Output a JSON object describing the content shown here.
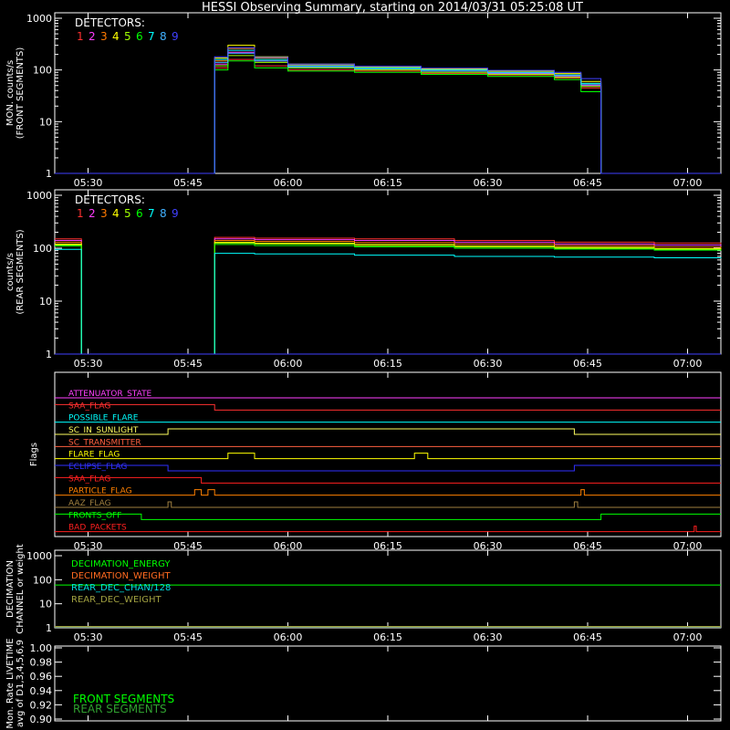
{
  "title": "HESSI Observing Summary, starting on 2014/03/31 05:25:08 UT",
  "detector_colors": [
    "#ff3030",
    "#ff3cff",
    "#ff7a00",
    "#ffff00",
    "#a0ff00",
    "#00ff00",
    "#00ffff",
    "#40b0ff",
    "#4040ff"
  ],
  "time_axis": {
    "start": "05:25:08",
    "end": "07:05",
    "ticks": [
      "05:30",
      "05:45",
      "06:00",
      "06:15",
      "06:30",
      "06:45",
      "07:00"
    ]
  },
  "chart_data": [
    {
      "type": "line",
      "id": "front",
      "ylabel": "MON. counts/s\n(FRONT SEGMENTS)",
      "yscale": "log",
      "ylim": [
        1,
        1000
      ],
      "yticks": [
        "1",
        "10",
        "100",
        "1000"
      ],
      "legend_title": "DETECTORS:",
      "legend_numbers": [
        "1",
        "2",
        "3",
        "4",
        "5",
        "6",
        "7",
        "8",
        "9"
      ],
      "x": [
        "05:25",
        "05:49",
        "05:49",
        "05:51",
        "05:55",
        "06:00",
        "06:10",
        "06:20",
        "06:30",
        "06:40",
        "06:44",
        "06:47",
        "06:47",
        "07:05"
      ],
      "series": [
        {
          "name": "1",
          "values": [
            1,
            1,
            110,
            160,
            120,
            100,
            95,
            85,
            80,
            70,
            45,
            40,
            1,
            1
          ]
        },
        {
          "name": "2",
          "values": [
            1,
            1,
            130,
            220,
            150,
            115,
            105,
            95,
            85,
            75,
            50,
            45,
            1,
            1
          ]
        },
        {
          "name": "3",
          "values": [
            1,
            1,
            150,
            260,
            170,
            125,
            110,
            100,
            90,
            80,
            55,
            50,
            1,
            1
          ]
        },
        {
          "name": "4",
          "values": [
            1,
            1,
            170,
            300,
            180,
            130,
            115,
            105,
            95,
            85,
            60,
            55,
            1,
            1
          ]
        },
        {
          "name": "5",
          "values": [
            1,
            1,
            120,
            190,
            140,
            110,
            100,
            90,
            82,
            72,
            48,
            42,
            1,
            1
          ]
        },
        {
          "name": "6",
          "values": [
            1,
            1,
            100,
            150,
            110,
            95,
            90,
            82,
            75,
            65,
            38,
            35,
            1,
            1
          ]
        },
        {
          "name": "7",
          "values": [
            1,
            1,
            160,
            240,
            160,
            120,
            110,
            100,
            90,
            80,
            55,
            48,
            1,
            1
          ]
        },
        {
          "name": "8",
          "values": [
            1,
            1,
            140,
            210,
            150,
            115,
            105,
            95,
            88,
            78,
            52,
            46,
            1,
            1
          ]
        },
        {
          "name": "9",
          "values": [
            1,
            1,
            180,
            270,
            175,
            130,
            118,
            108,
            98,
            90,
            68,
            60,
            1,
            1
          ]
        }
      ]
    },
    {
      "type": "line",
      "id": "rear",
      "ylabel": "counts/s\n(REAR SEGMENTS)",
      "yscale": "log",
      "ylim": [
        1,
        1000
      ],
      "yticks": [
        "1",
        "10",
        "100",
        "1000"
      ],
      "legend_title": "DETECTORS:",
      "legend_numbers": [
        "1",
        "2",
        "3",
        "4",
        "5",
        "6",
        "7",
        "8",
        "9"
      ],
      "x": [
        "05:25",
        "05:29",
        "05:29",
        "05:49",
        "05:49",
        "05:55",
        "06:10",
        "06:25",
        "06:40",
        "06:55",
        "07:05"
      ],
      "series": [
        {
          "name": "1",
          "values": [
            150,
            150,
            1,
            1,
            160,
            155,
            150,
            140,
            130,
            125,
            120
          ]
        },
        {
          "name": "2",
          "values": [
            140,
            140,
            1,
            1,
            150,
            145,
            140,
            130,
            120,
            115,
            110
          ]
        },
        {
          "name": "3",
          "values": [
            130,
            130,
            1,
            1,
            140,
            135,
            128,
            120,
            112,
            105,
            100
          ]
        },
        {
          "name": "4",
          "values": [
            120,
            120,
            1,
            1,
            130,
            125,
            118,
            110,
            104,
            98,
            95
          ]
        },
        {
          "name": "5",
          "values": [
            115,
            115,
            1,
            1,
            125,
            120,
            112,
            105,
            100,
            95,
            92
          ]
        },
        {
          "name": "6",
          "values": [
            110,
            110,
            1,
            1,
            118,
            112,
            106,
            100,
            96,
            92,
            90
          ]
        },
        {
          "name": "7",
          "values": [
            95,
            95,
            1,
            1,
            80,
            78,
            74,
            70,
            68,
            66,
            65
          ]
        },
        {
          "name": "8",
          "values": [
            1,
            1,
            1,
            1,
            1,
            1,
            1,
            1,
            1,
            1,
            1
          ]
        },
        {
          "name": "9",
          "values": [
            1,
            1,
            1,
            1,
            1,
            1,
            1,
            1,
            1,
            1,
            1
          ]
        }
      ]
    },
    {
      "type": "line",
      "id": "flags",
      "ylabel": "Flags",
      "flags": [
        {
          "name": "ATTENUATOR_STATE",
          "color": "#ff40ff",
          "steps": [
            [
              "05:25",
              0
            ]
          ]
        },
        {
          "name": "SAA_FLAG",
          "color": "#ff3030",
          "steps": [
            [
              "05:25",
              1
            ],
            [
              "05:49",
              0
            ]
          ]
        },
        {
          "name": "POSSIBLE_FLARE",
          "color": "#00ffff",
          "steps": [
            [
              "05:25",
              0
            ]
          ]
        },
        {
          "name": "SC_IN_SUNLIGHT",
          "color": "#ffff60",
          "steps": [
            [
              "05:25",
              0
            ],
            [
              "05:42",
              1
            ],
            [
              "06:43",
              0
            ]
          ]
        },
        {
          "name": "SC_TRANSMITTER",
          "color": "#ff6040",
          "steps": [
            [
              "05:25",
              0
            ]
          ]
        },
        {
          "name": "FLARE_FLAG",
          "color": "#ffff00",
          "steps": [
            [
              "05:25",
              0
            ],
            [
              "05:51",
              1
            ],
            [
              "05:55",
              0
            ],
            [
              "06:19",
              1
            ],
            [
              "06:21",
              0
            ]
          ]
        },
        {
          "name": "ECLIPSE_FLAG",
          "color": "#3030ff",
          "steps": [
            [
              "05:25",
              1
            ],
            [
              "05:42",
              0
            ],
            [
              "06:43",
              1
            ]
          ]
        },
        {
          "name": "SAA_FLAG",
          "color": "#ff2020",
          "steps": [
            [
              "05:25",
              1
            ],
            [
              "05:47",
              0
            ]
          ]
        },
        {
          "name": "PARTICLE_FLAG",
          "color": "#ff8000",
          "steps": [
            [
              "05:25",
              0
            ],
            [
              "05:46",
              1
            ],
            [
              "05:47",
              0
            ],
            [
              "05:48",
              1
            ],
            [
              "05:49",
              0
            ],
            [
              "06:44",
              1
            ],
            [
              "06:44.5",
              0
            ]
          ]
        },
        {
          "name": "AAZ_FLAG",
          "color": "#a08040",
          "steps": [
            [
              "05:25",
              0
            ],
            [
              "05:42",
              1
            ],
            [
              "05:42.5",
              0
            ],
            [
              "06:43",
              1
            ],
            [
              "06:43.5",
              0
            ]
          ]
        },
        {
          "name": "FRONTS_OFF",
          "color": "#00ff00",
          "steps": [
            [
              "05:25",
              1
            ],
            [
              "05:38",
              0
            ],
            [
              "06:47",
              1
            ]
          ]
        },
        {
          "name": "BAD_PACKETS",
          "color": "#ff2020",
          "steps": [
            [
              "05:25",
              0
            ],
            [
              "07:01",
              1
            ],
            [
              "07:01.3",
              0
            ]
          ]
        }
      ]
    },
    {
      "type": "line",
      "id": "decimation",
      "ylabel": "DECIMATION\nCHANNEL or weight",
      "yscale": "log",
      "ylim": [
        1,
        1000
      ],
      "yticks": [
        "1",
        "10",
        "100",
        "1000"
      ],
      "legend": [
        {
          "name": "DECIMATION_ENERGY",
          "color": "#00ff00"
        },
        {
          "name": "DECIMATION_WEIGHT",
          "color": "#ff6a20"
        },
        {
          "name": "REAR_DEC_CHAN/128",
          "color": "#00e0e0"
        },
        {
          "name": "REAR_DEC_WEIGHT",
          "color": "#a0a040"
        }
      ],
      "series": [
        {
          "name": "DECIMATION_ENERGY",
          "values": [
            60,
            60
          ]
        },
        {
          "name": "DECIMATION_WEIGHT",
          "values": [
            1,
            1
          ]
        },
        {
          "name": "REAR_DEC_CHAN/128",
          "values": [
            1,
            1
          ]
        },
        {
          "name": "REAR_DEC_WEIGHT",
          "values": [
            1,
            1
          ]
        }
      ]
    },
    {
      "type": "line",
      "id": "livetime",
      "ylabel": "Mon. Rate LIVETIME\navg of D1,3,4,5,6,9",
      "ylim": [
        0.9,
        1.0
      ],
      "yticks": [
        "0.90",
        "0.92",
        "0.94",
        "0.96",
        "0.98",
        "1.00"
      ],
      "legend": [
        {
          "name": "FRONT SEGMENTS",
          "color": "#00ff00"
        },
        {
          "name": "REAR SEGMENTS",
          "color": "#30a030"
        }
      ]
    }
  ]
}
